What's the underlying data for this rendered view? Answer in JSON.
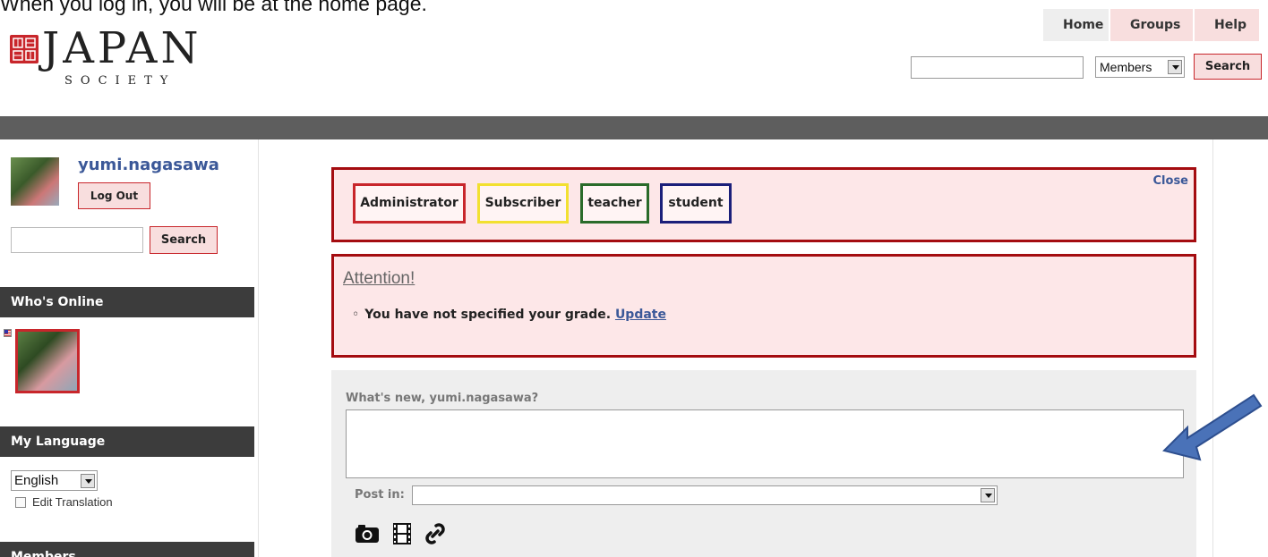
{
  "caption": "When you log in, you will be at the home page.",
  "logo": {
    "word": "JAPAN",
    "sub": "SOCIETY"
  },
  "topnav": [
    {
      "label": "Home"
    },
    {
      "label": "Groups"
    },
    {
      "label": "Help"
    }
  ],
  "top_search": {
    "select_value": "Members",
    "button": "Search"
  },
  "user": {
    "name": "yumi.nagasawa",
    "logout": "Log Out"
  },
  "side_search": {
    "button": "Search"
  },
  "sections": {
    "online": "Who's Online",
    "language": "My Language",
    "members": "Members"
  },
  "language": {
    "selected": "English",
    "edit_translation": "Edit Translation"
  },
  "roles": {
    "close": "Close",
    "items": [
      {
        "label": "Administrator",
        "color": "#c8262b"
      },
      {
        "label": "Subscriber",
        "color": "#f2e030"
      },
      {
        "label": "teacher",
        "color": "#2a6b2a"
      },
      {
        "label": "student",
        "color": "#1b1f7a"
      }
    ]
  },
  "attention": {
    "title": "Attention!",
    "message": "You have not specified your grade.",
    "link": "Update"
  },
  "post": {
    "prompt": "What's new, yumi.nagasawa?",
    "post_in_label": "Post in:"
  },
  "icons": [
    "camera-icon",
    "film-icon",
    "link-icon"
  ],
  "accent_colors": {
    "brand_red": "#c8262b",
    "box_border": "#a40c10",
    "box_bg": "#fde7e8",
    "link_blue": "#3b5898",
    "arrow_blue": "#4a72b8"
  }
}
